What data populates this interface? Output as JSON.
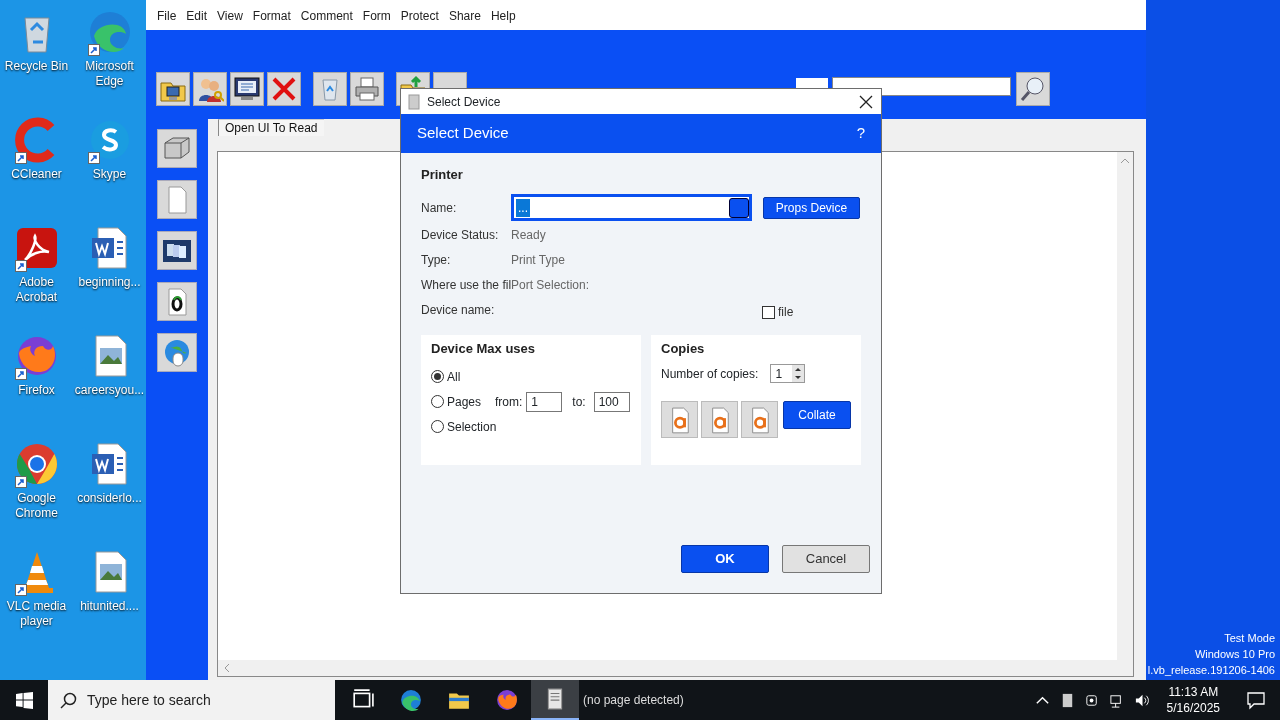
{
  "desktop_icons": [
    {
      "label": "Recycle Bin",
      "kind": "recycle",
      "shortcut": false
    },
    {
      "label": "Microsoft Edge",
      "kind": "edge",
      "shortcut": true
    },
    {
      "label": "CCleaner",
      "kind": "ccleaner",
      "shortcut": true
    },
    {
      "label": "Skype",
      "kind": "skype",
      "shortcut": true
    },
    {
      "label": "Adobe Acrobat",
      "kind": "acrobat",
      "shortcut": true
    },
    {
      "label": "beginning...",
      "kind": "word",
      "shortcut": false
    },
    {
      "label": "Firefox",
      "kind": "firefox",
      "shortcut": true
    },
    {
      "label": "careersyou...",
      "kind": "image",
      "shortcut": false
    },
    {
      "label": "Google Chrome",
      "kind": "chrome",
      "shortcut": true
    },
    {
      "label": "considerlo...",
      "kind": "word",
      "shortcut": false
    },
    {
      "label": "VLC media player",
      "kind": "vlc",
      "shortcut": true
    },
    {
      "label": "hitunited....",
      "kind": "image",
      "shortcut": false
    }
  ],
  "app": {
    "menu": [
      "File",
      "Edit",
      "View",
      "Format",
      "Comment",
      "Form",
      "Protect",
      "Share",
      "Help"
    ],
    "tab": "Open UI To Read"
  },
  "dialog": {
    "title": "Select Device",
    "header": "Select Device",
    "help": "?",
    "section": "Printer",
    "name_label": "Name:",
    "name_value": "...",
    "props_button": "Props Device",
    "fields": [
      {
        "label": "Device Status:",
        "value": "Ready"
      },
      {
        "label": "Type:",
        "value": "Print Type"
      },
      {
        "label": "Where use the fil",
        "value": "Port Selection:"
      },
      {
        "label": "Device name:"
      }
    ],
    "file_checkbox": {
      "label": "file",
      "checked": false
    },
    "range": {
      "title": "Device Max uses",
      "options": [
        {
          "label": "All",
          "selected": true
        },
        {
          "label": "Pages",
          "selected": false
        },
        {
          "label": "Selection",
          "selected": false
        }
      ],
      "from_label": "from:",
      "from_value": "1",
      "to_label": "to:",
      "to_value": "100"
    },
    "copies": {
      "title": "Copies",
      "count_label": "Number of copies:",
      "count_value": "1",
      "collate_button": "Collate"
    },
    "buttons": [
      {
        "label": "OK",
        "kind": "primary"
      },
      {
        "label": "Cancel",
        "kind": "secondary"
      }
    ]
  },
  "desktop_text": [
    "Test Mode",
    "Windows 10 Pro",
    "l.vb_release.191206-1406"
  ],
  "taskbar": {
    "search_placeholder": "Type here to search",
    "apps": [
      {
        "kind": "taskview"
      },
      {
        "kind": "edge"
      },
      {
        "kind": "explorer"
      },
      {
        "kind": "firefox"
      },
      {
        "kind": "printer-app",
        "label": "(no page detected)",
        "selected": true
      }
    ],
    "time": "11:13 AM",
    "date": "5/16/2025"
  }
}
